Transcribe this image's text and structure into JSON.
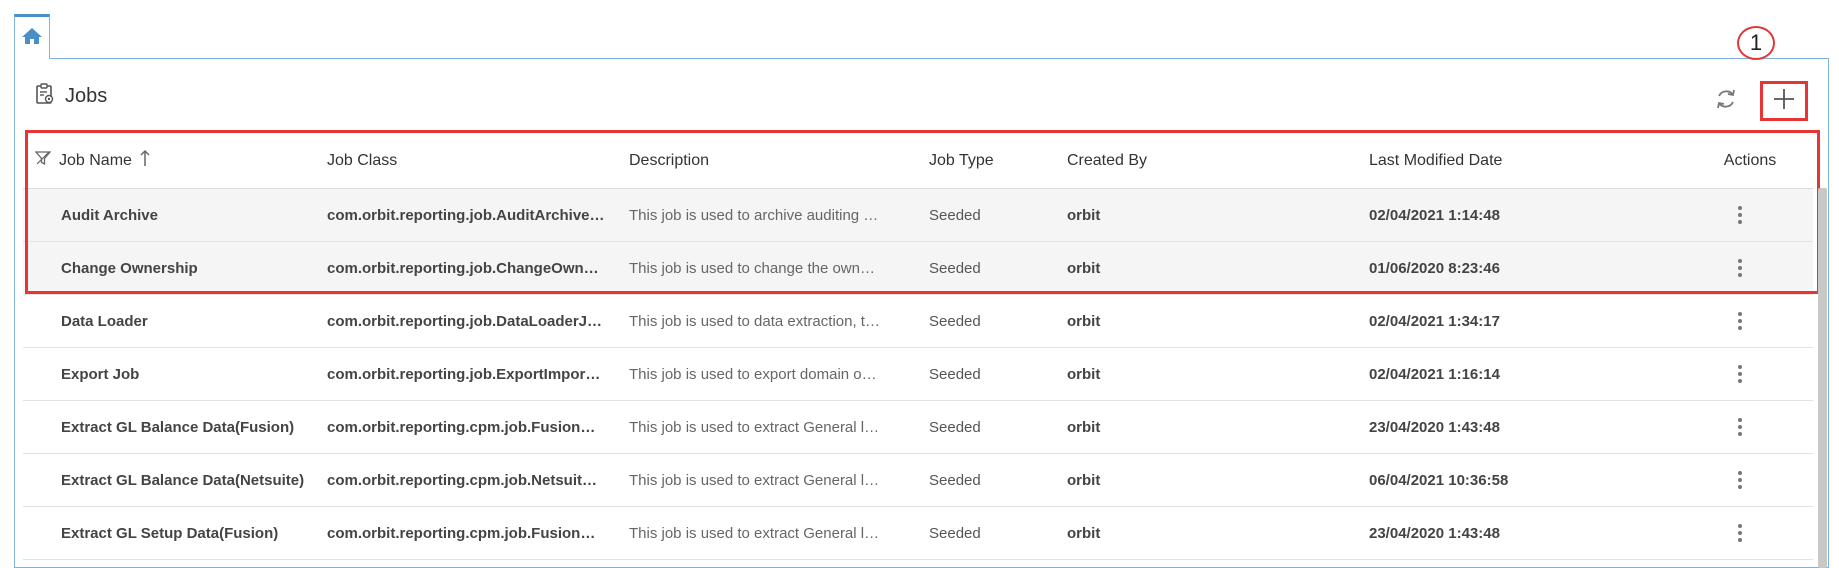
{
  "home_tab": {
    "icon": "home-icon"
  },
  "header": {
    "title": "Jobs",
    "title_icon": "clipboard-gear-icon",
    "refresh_icon": "refresh-icon",
    "add_icon": "plus-icon",
    "callout_number": "1"
  },
  "table": {
    "columns": {
      "filter_icon": "filter-icon",
      "job_name": "Job Name",
      "sort_icon": "sort-ascending-icon",
      "job_class": "Job Class",
      "description": "Description",
      "job_type": "Job Type",
      "created_by": "Created By",
      "last_modified": "Last Modified Date",
      "actions": "Actions"
    },
    "rows": [
      {
        "name": "Audit Archive",
        "class": "com.orbit.reporting.job.AuditArchive…",
        "description": "This job is used to archive auditing …",
        "type": "Seeded",
        "created_by": "orbit",
        "modified": "02/04/2021 1:14:48"
      },
      {
        "name": "Change Ownership",
        "class": "com.orbit.reporting.job.ChangeOwn…",
        "description": "This job is used to change the own…",
        "type": "Seeded",
        "created_by": "orbit",
        "modified": "01/06/2020 8:23:46"
      },
      {
        "name": "Data Loader",
        "class": "com.orbit.reporting.job.DataLoaderJ…",
        "description": "This job is used to data extraction, t…",
        "type": "Seeded",
        "created_by": "orbit",
        "modified": "02/04/2021 1:34:17"
      },
      {
        "name": "Export Job",
        "class": "com.orbit.reporting.job.ExportImpor…",
        "description": "This job is used to export domain o…",
        "type": "Seeded",
        "created_by": "orbit",
        "modified": "02/04/2021 1:16:14"
      },
      {
        "name": "Extract GL Balance Data(Fusion)",
        "class": "com.orbit.reporting.cpm.job.Fusion…",
        "description": "This job is used to extract General l…",
        "type": "Seeded",
        "created_by": "orbit",
        "modified": "23/04/2020 1:43:48"
      },
      {
        "name": "Extract GL Balance Data(Netsuite)",
        "class": "com.orbit.reporting.cpm.job.Netsuit…",
        "description": "This job is used to extract General l…",
        "type": "Seeded",
        "created_by": "orbit",
        "modified": "06/04/2021 10:36:58"
      },
      {
        "name": "Extract GL Setup Data(Fusion)",
        "class": "com.orbit.reporting.cpm.job.Fusion…",
        "description": "This job is used to extract General l…",
        "type": "Seeded",
        "created_by": "orbit",
        "modified": "23/04/2020 1:43:48"
      }
    ],
    "row_action_icon": "more-vertical-icon"
  },
  "colors": {
    "highlight": "#e53535",
    "tab_accent": "#4a90c8",
    "panel_border": "#7fb3d9"
  }
}
